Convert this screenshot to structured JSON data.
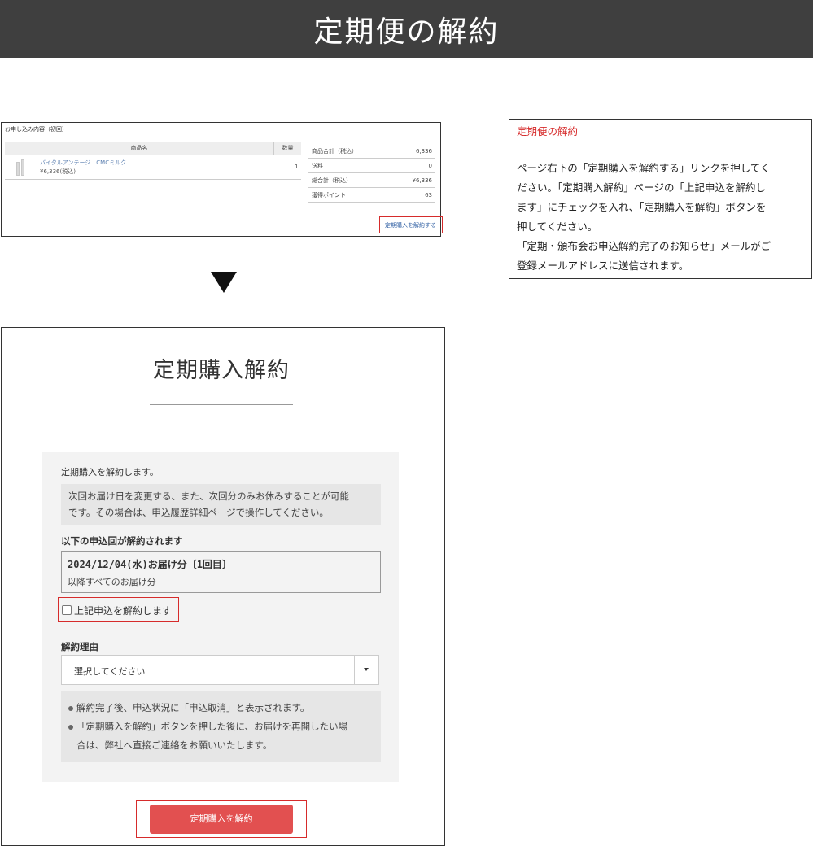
{
  "header": {
    "title": "定期便の解約"
  },
  "order_screenshot": {
    "heading": "お申し込み内容（初回）",
    "columns": [
      "商品名",
      "数量"
    ],
    "item": {
      "name": "バイタルアンテージ　CMCミルク",
      "price": "¥6,336(税込)",
      "qty": "1"
    },
    "totals": [
      {
        "label": "商品合計（税込）",
        "value": "6,336"
      },
      {
        "label": "送料",
        "value": "0"
      },
      {
        "label": "総合計（税込）",
        "value": "¥6,336"
      },
      {
        "label": "獲得ポイント",
        "value": "63"
      }
    ],
    "cancel_link": "定期購入を解約する"
  },
  "note": {
    "title": "定期便の解約",
    "lines": [
      "ページ右下の「定期購入を解約する」リンクを押してく",
      "ださい。「定期購入解約」ページの「上記申込を解約し",
      "ます」にチェックを入れ、「定期購入を解約」ボタンを",
      "押してください。",
      "「定期・頒布会お申込解約完了のお知らせ」メールがご",
      "登録メールアドレスに送信されます。"
    ]
  },
  "cancel_page": {
    "title": "定期購入解約",
    "intro": "定期購入を解約します。",
    "info": [
      "次回お届け日を変更する、また、次回分のみお休みすることが可能",
      "です。その場合は、申込履歴詳細ページで操作してください。"
    ],
    "target_heading": "以下の申込回が解約されます",
    "schedule_date": "2024/12/04(水)お届け分〔1回目〕",
    "schedule_sub": "以降すべてのお届け分",
    "confirm_label": "上記申込を解約します",
    "reason_label": "解約理由",
    "reason_select": "選択してください",
    "notes": [
      "解約完了後、申込状況に「申込取消」と表示されます。",
      "「定期購入を解約」ボタンを押した後に、お届けを再開したい場",
      "合は、弊社へ直接ご連絡をお願いいたします。"
    ],
    "submit_label": "定期購入を解約"
  }
}
